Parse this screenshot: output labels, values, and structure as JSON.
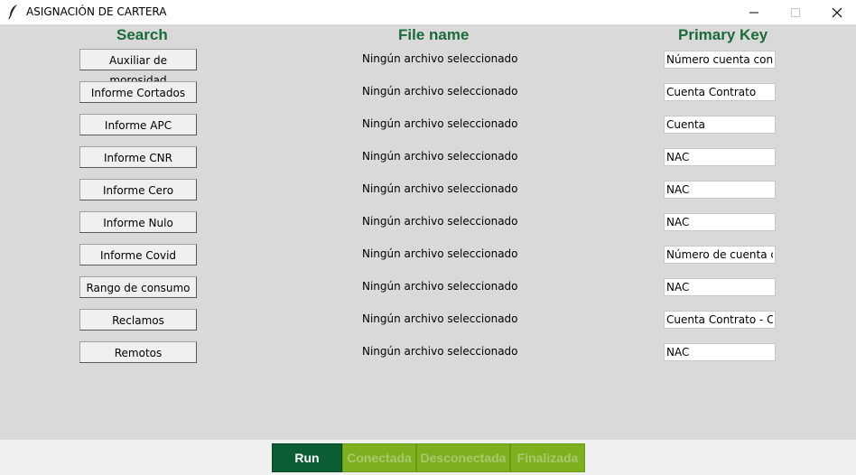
{
  "window": {
    "title": "ASIGNACIÓN DE CARTERA"
  },
  "headers": {
    "search": "Search",
    "file_name": "File name",
    "primary_key": "Primary Key"
  },
  "rows": [
    {
      "button": "Auxiliar de morosidad",
      "file": "Ningún archivo seleccionado",
      "key": "Número cuenta contrato"
    },
    {
      "button": "Informe Cortados",
      "file": "Ningún archivo seleccionado",
      "key": "Cuenta Contrato"
    },
    {
      "button": "Informe APC",
      "file": "Ningún archivo seleccionado",
      "key": "Cuenta"
    },
    {
      "button": "Informe CNR",
      "file": "Ningún archivo seleccionado",
      "key": "NAC"
    },
    {
      "button": "Informe Cero",
      "file": "Ningún archivo seleccionado",
      "key": "NAC"
    },
    {
      "button": "Informe Nulo",
      "file": "Ningún archivo seleccionado",
      "key": "NAC"
    },
    {
      "button": "Informe Covid",
      "file": "Ningún archivo seleccionado",
      "key": "Número de cuenta contrato"
    },
    {
      "button": "Rango de consumo",
      "file": "Ningún archivo seleccionado",
      "key": "NAC"
    },
    {
      "button": "Reclamos",
      "file": "Ningún archivo seleccionado",
      "key": "Cuenta Contrato - Clave"
    },
    {
      "button": "Remotos",
      "file": "Ningún archivo seleccionado",
      "key": "NAC"
    }
  ],
  "footer": {
    "run": "Run",
    "connected": "Conectada",
    "disconnected": "Desconectada",
    "finished": "Finalizada"
  },
  "colors": {
    "header_text": "#1a6b3a",
    "run_bg": "#0b5e33",
    "status_bg": "#7daf1e"
  }
}
